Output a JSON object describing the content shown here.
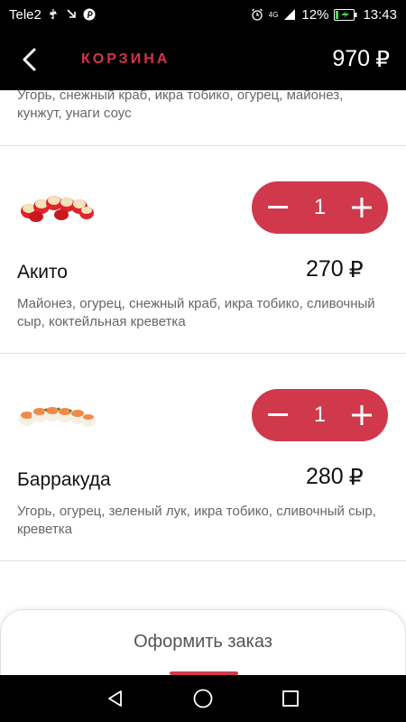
{
  "status_bar": {
    "carrier": "Tele2",
    "network": "4G",
    "battery": "12%",
    "time": "13:43"
  },
  "app_bar": {
    "title": "КОРЗИНА",
    "total_amount": "970",
    "currency": "₽"
  },
  "cart": {
    "top_item_desc": "Угорь, снежный краб, икра тобико, огурец, майонез, кунжут, унаги соус",
    "items": [
      {
        "name": "Акито",
        "quantity": "1",
        "price": "270",
        "currency": "₽",
        "description": "Майонез, огурец, снежный краб, икра тобико, сливочный сыр, коктейльная креветка"
      },
      {
        "name": "Барракуда",
        "quantity": "1",
        "price": "280",
        "currency": "₽",
        "description": "Угорь, огурец, зеленый лук, икра тобико, сливочный сыр, креветка"
      }
    ]
  },
  "order": {
    "button_label": "Оформить заказ"
  },
  "colors": {
    "accent": "#d0384c",
    "title_red": "#d2344a"
  }
}
